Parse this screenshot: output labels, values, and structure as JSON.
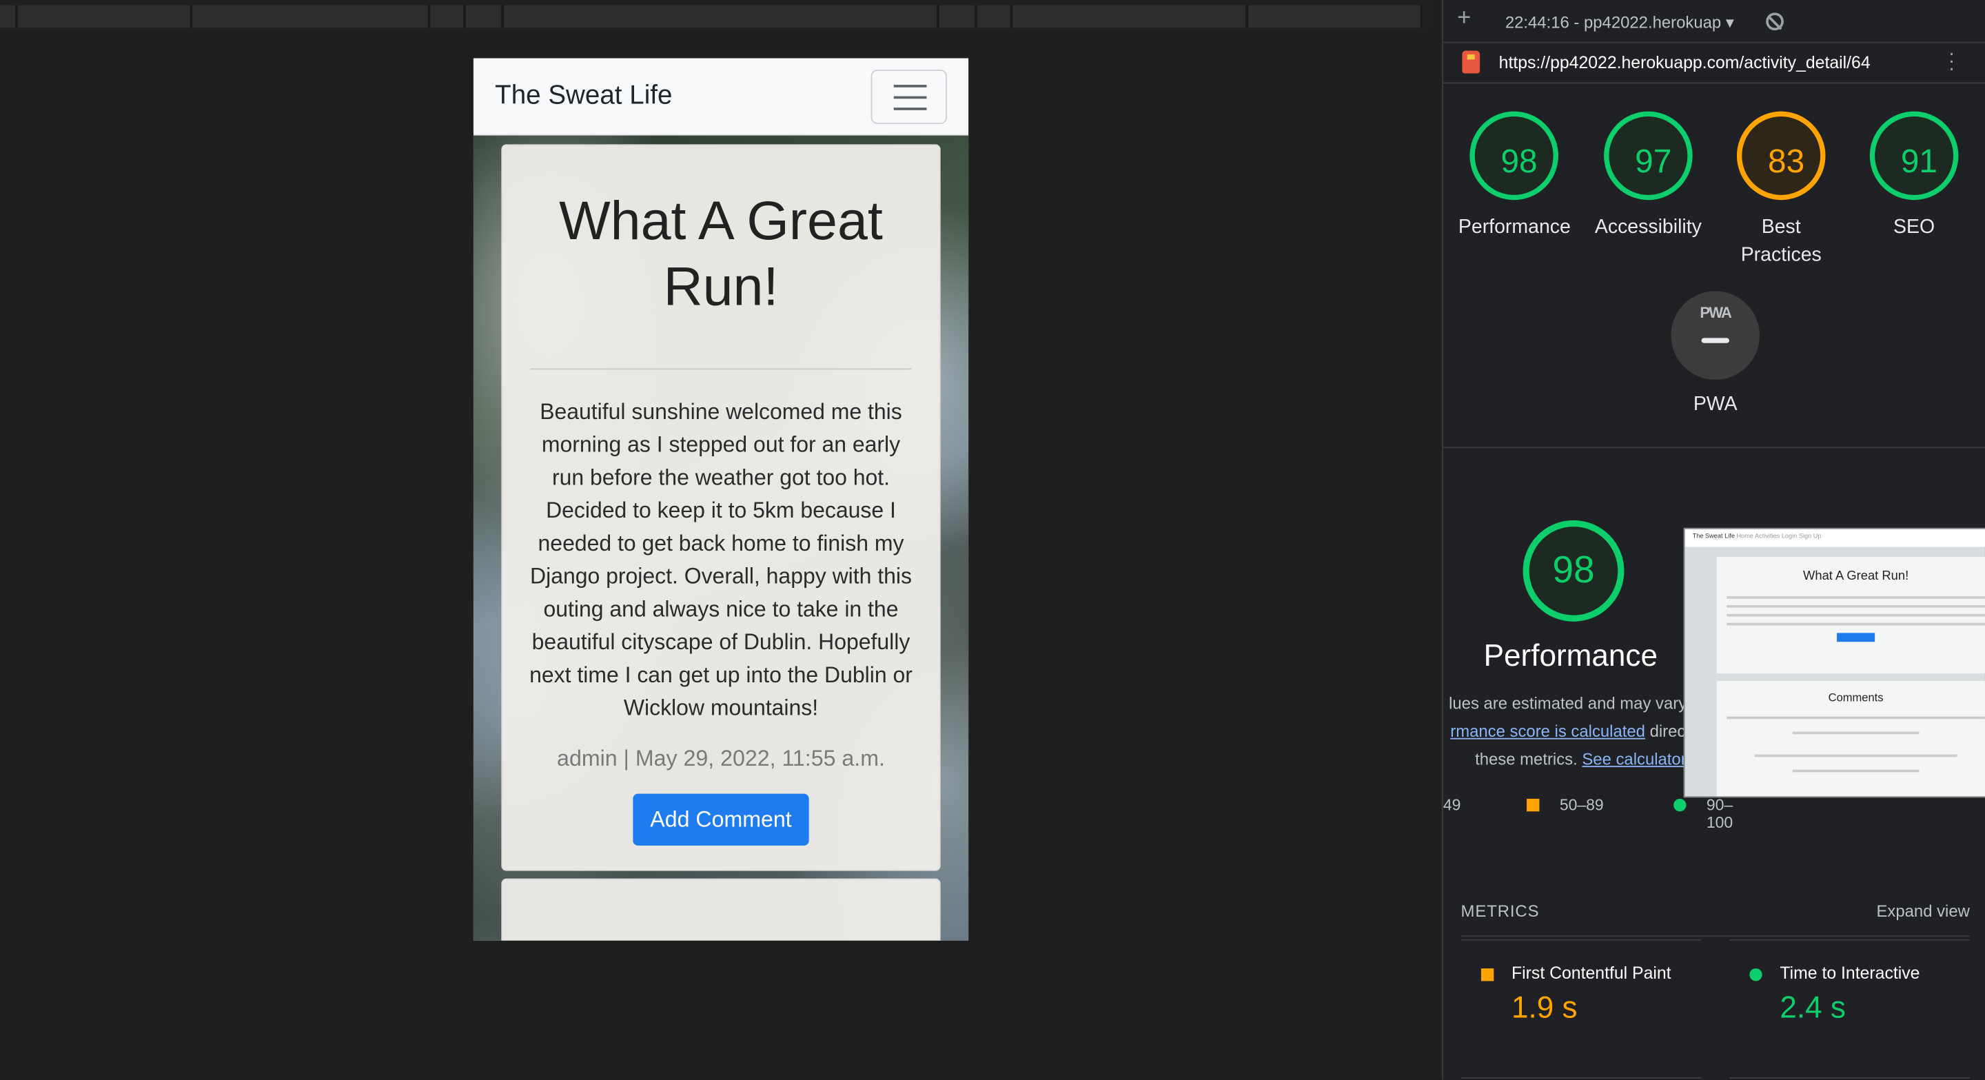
{
  "page": {
    "brand": "The Sweat Life",
    "title": "What A Great Run!",
    "body": "Beautiful sunshine welcomed me this morning as I stepped out for an early run before the weather got too hot. Decided to keep it to 5km because I needed to get back home to finish my Django project. Overall, happy with this outing and always nice to take in the beautiful cityscape of Dublin. Hopefully next time I can get up into the Dublin or Wicklow mountains!",
    "meta": "admin | May 29, 2022, 11:55 a.m.",
    "add_comment": "Add Comment"
  },
  "lighthouse": {
    "time": "22:44:16 - pp42022.herokuap",
    "url": "https://pp42022.herokuapp.com/activity_detail/64",
    "scores": [
      {
        "label": "Performance",
        "value": "98"
      },
      {
        "label": "Accessibility",
        "value": "97"
      },
      {
        "label": "Best Practices",
        "value": "83"
      },
      {
        "label": "SEO",
        "value": "91"
      }
    ],
    "pwa_icon_text": "PWA",
    "pwa_label": "PWA",
    "perf_score": "98",
    "perf_title": "Performance",
    "desc_line1": "lues are estimated and may vary.",
    "desc_link1": "rmance score is calculated",
    "desc_line2_tail": " direct",
    "desc_line3": "these metrics. ",
    "desc_link2": "See calculator.",
    "legend": {
      "low": "49",
      "mid": "50–89",
      "high": "90–100"
    },
    "thumb": {
      "brand": "The Sweat Life",
      "nav": "Home   Activities   Login   Sign Up",
      "title": "What A Great Run!",
      "comments": "Comments"
    },
    "metrics_header": "METRICS",
    "expand": "Expand view",
    "metrics": [
      {
        "name": "First Contentful Paint",
        "value": "1.9 s",
        "color": "#ffa400"
      },
      {
        "name": "Time to Interactive",
        "value": "2.4 s",
        "color": "#0cce6b"
      }
    ]
  }
}
